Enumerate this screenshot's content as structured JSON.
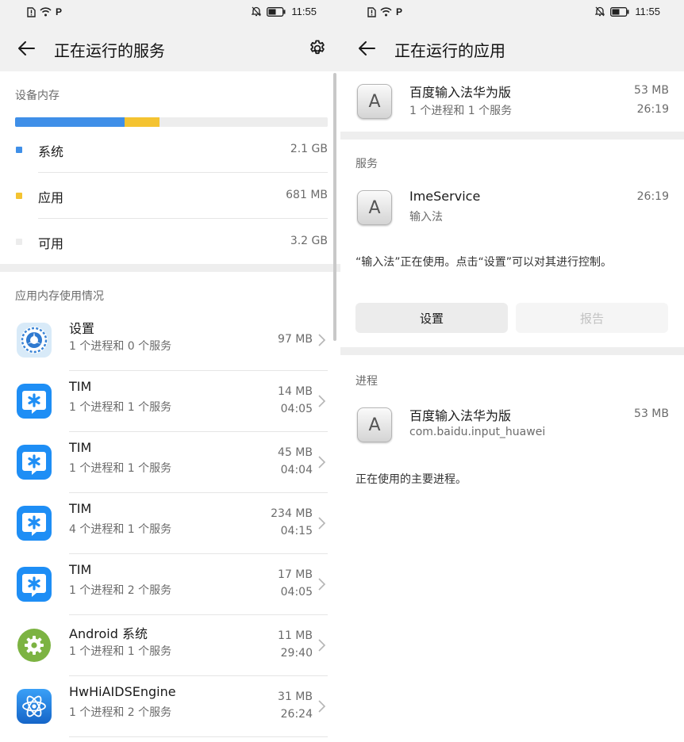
{
  "status_bar": {
    "time": "11:55",
    "p_label": "P"
  },
  "left": {
    "header": {
      "title": "正在运行的服务"
    },
    "device_memory": {
      "label": "设备内存",
      "bar": [
        {
          "name": "系统",
          "fraction": 0.35,
          "color": "#3f8fe8"
        },
        {
          "name": "应用",
          "fraction": 0.112,
          "color": "#f4c331"
        },
        {
          "name": "可用",
          "fraction": 0.538,
          "color": "#ededed"
        }
      ],
      "legend": [
        {
          "label": "系统",
          "value": "2.1 GB",
          "color": "#3f8fe8"
        },
        {
          "label": "应用",
          "value": "681 MB",
          "color": "#f4c331"
        },
        {
          "label": "可用",
          "value": "3.2 GB",
          "color": "#ececec"
        }
      ]
    },
    "app_memory": {
      "label": "应用内存使用情况",
      "apps": [
        {
          "name": "设置",
          "sub": "1 个进程和 0 个服务",
          "size": "97 MB",
          "time": "",
          "icon": "settings-app-icon"
        },
        {
          "name": "TIM",
          "sub": "1 个进程和 1 个服务",
          "size": "14 MB",
          "time": "04:05",
          "icon": "tim-app-icon"
        },
        {
          "name": "TIM",
          "sub": "1 个进程和 1 个服务",
          "size": "45 MB",
          "time": "04:04",
          "icon": "tim-app-icon"
        },
        {
          "name": "TIM",
          "sub": "4 个进程和 1 个服务",
          "size": "234 MB",
          "time": "04:15",
          "icon": "tim-app-icon"
        },
        {
          "name": "TIM",
          "sub": "1 个进程和 2 个服务",
          "size": "17 MB",
          "time": "04:05",
          "icon": "tim-app-icon"
        },
        {
          "name": "Android 系统",
          "sub": "1 个进程和 1 个服务",
          "size": "11 MB",
          "time": "29:40",
          "icon": "android-system-icon"
        },
        {
          "name": "HwHiAIDSEngine",
          "sub": "1 个进程和 2 个服务",
          "size": "31 MB",
          "time": "26:24",
          "icon": "atom-app-icon"
        }
      ]
    }
  },
  "right": {
    "header": {
      "title": "正在运行的应用"
    },
    "app": {
      "icon_letter": "A",
      "name": "百度输入法华为版",
      "sub": "1 个进程和 1 个服务",
      "size": "53 MB",
      "time": "26:19"
    },
    "services": {
      "label": "服务",
      "item": {
        "icon_letter": "A",
        "name": "ImeService",
        "sub": "输入法",
        "time": "26:19"
      },
      "description": "“输入法”正在使用。点击“设置”可以对其进行控制。",
      "settings_button": "设置",
      "report_button": "报告"
    },
    "processes": {
      "label": "进程",
      "item": {
        "icon_letter": "A",
        "name": "百度输入法华为版",
        "sub": "com.baidu.input_huawei",
        "size": "53 MB"
      },
      "description": "正在使用的主要进程。"
    }
  }
}
